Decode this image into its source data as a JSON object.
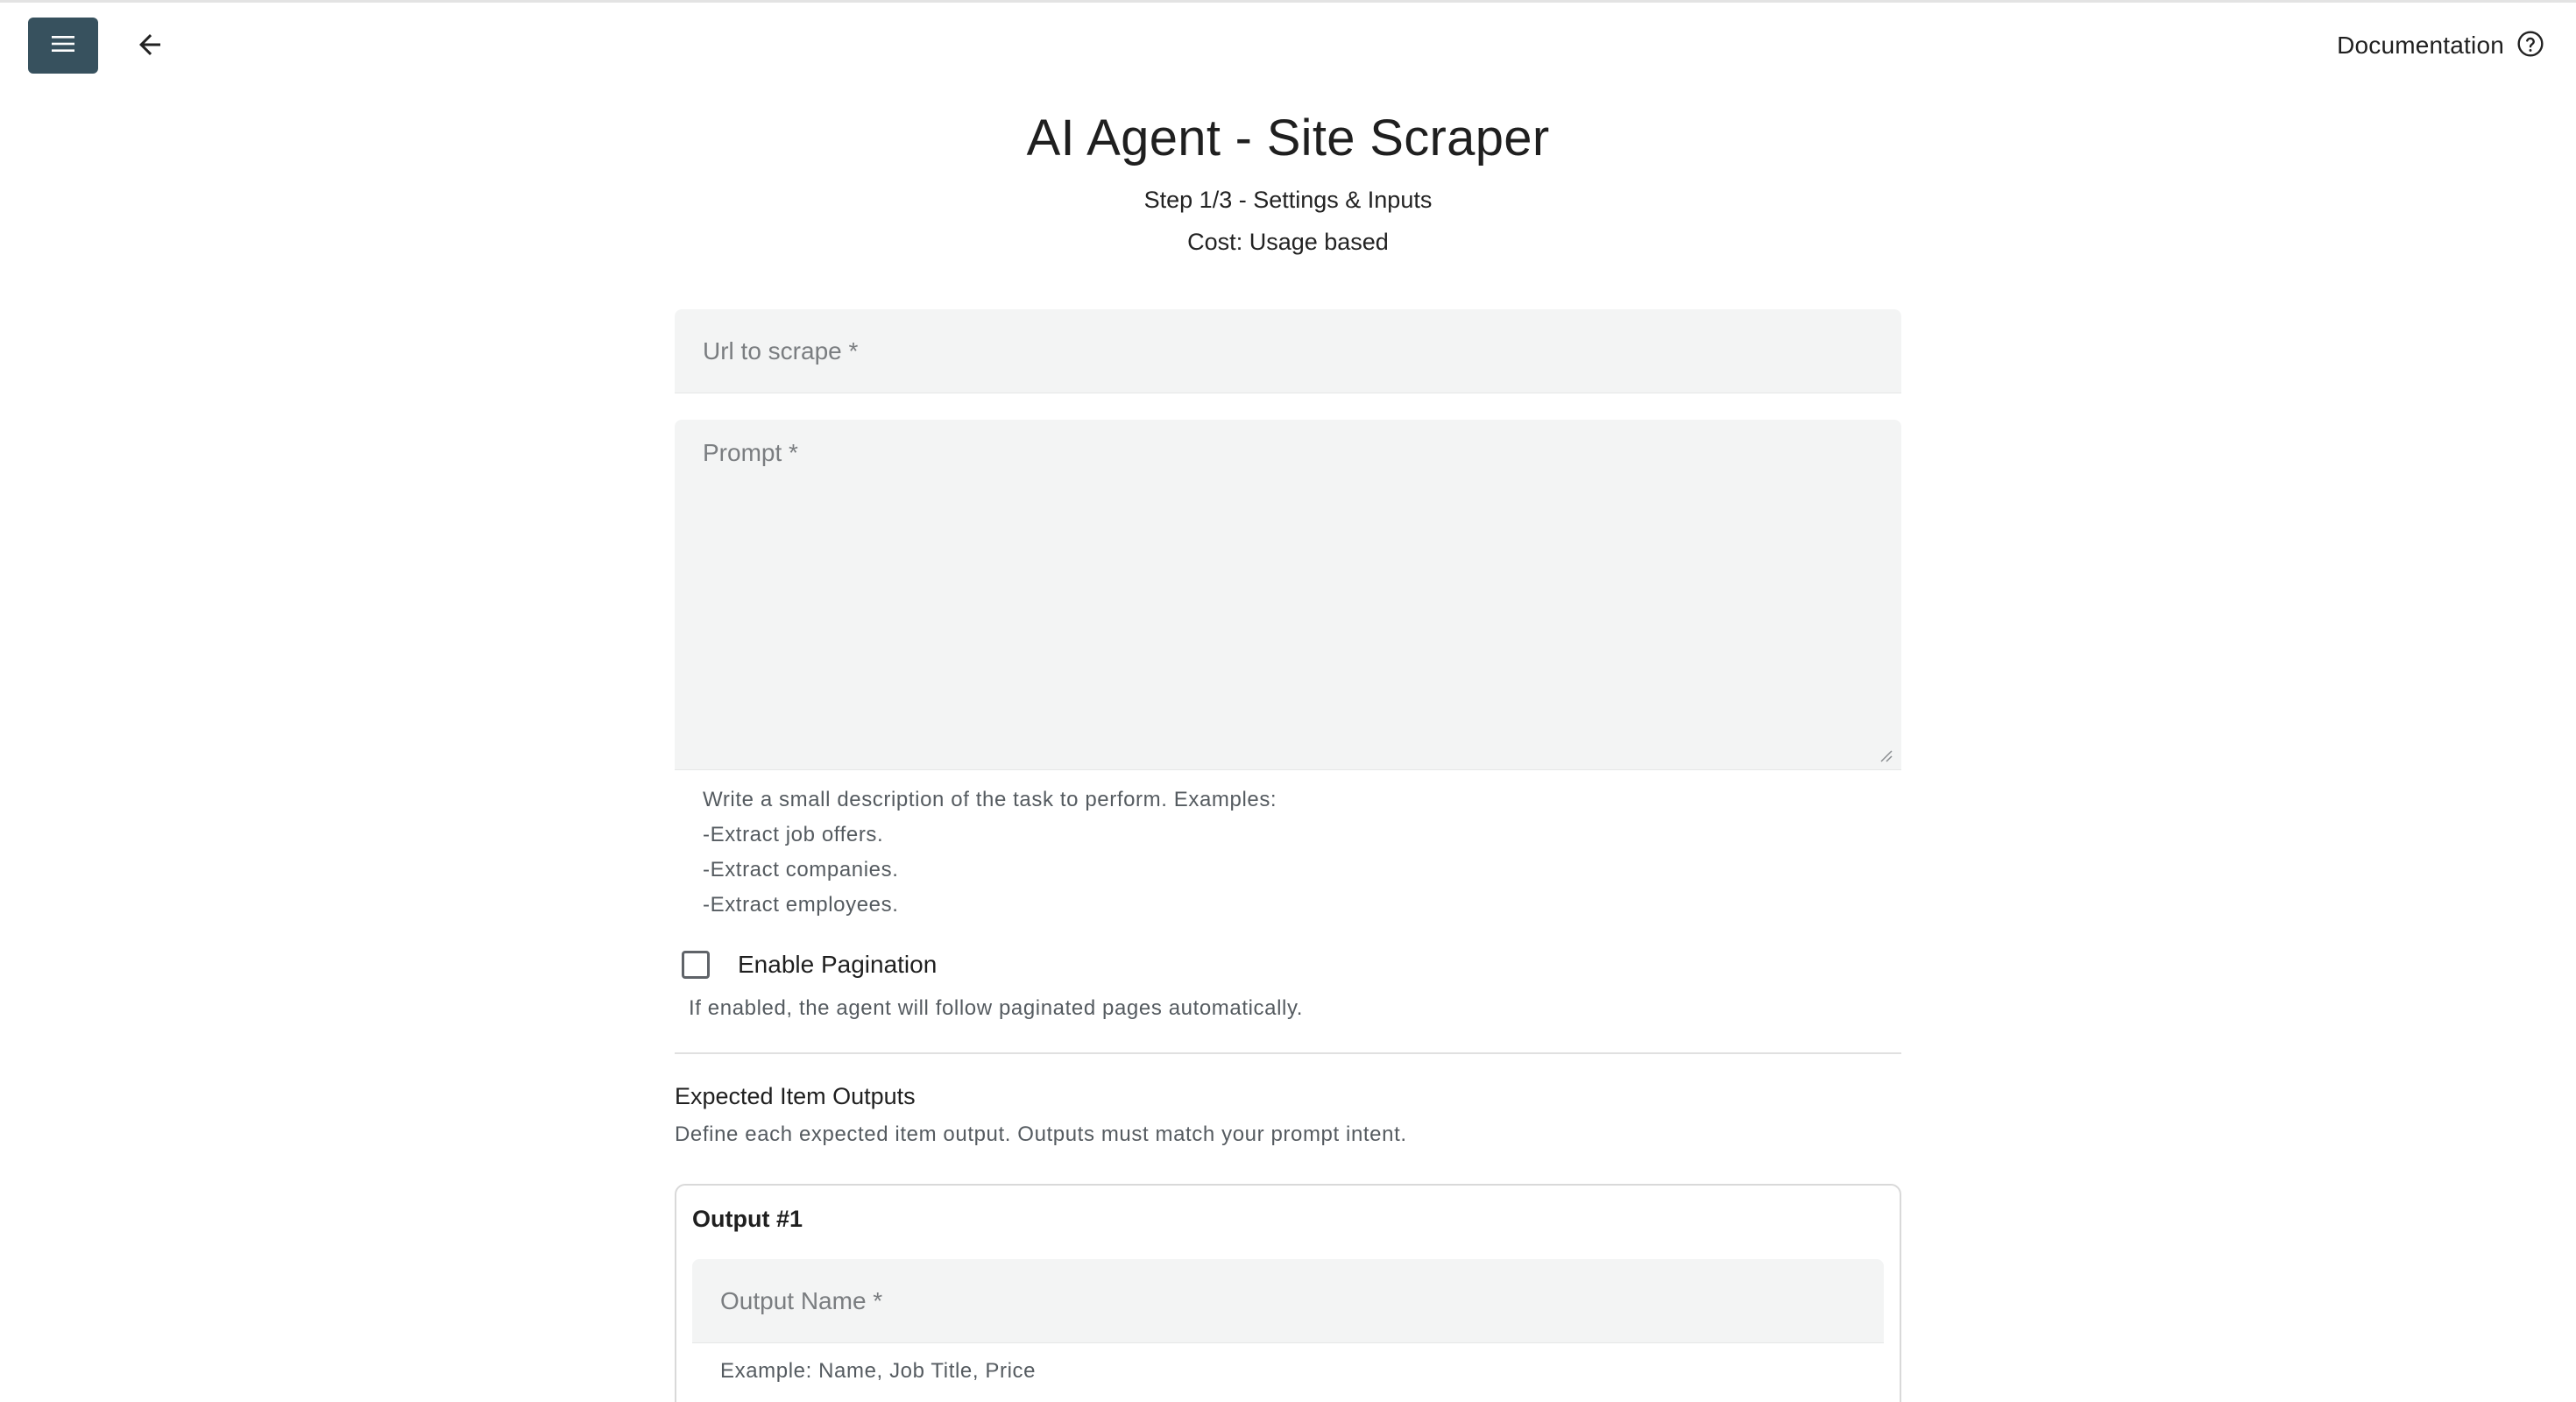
{
  "header": {
    "documentation_label": "Documentation"
  },
  "page": {
    "title": "AI Agent - Site Scraper",
    "step": "Step 1/3 - Settings & Inputs",
    "cost": "Cost: Usage based"
  },
  "form": {
    "url_label": "Url to scrape *",
    "prompt_label": "Prompt *",
    "prompt_helper": [
      "Write a small description of the task to perform. Examples:",
      "-Extract job offers.",
      "-Extract companies.",
      "-Extract employees."
    ],
    "pagination_label": "Enable Pagination",
    "pagination_checked": false,
    "pagination_hint": "If enabled, the agent will follow paginated pages automatically."
  },
  "outputs": {
    "section_title": "Expected Item Outputs",
    "section_desc": "Define each expected item output. Outputs must match your prompt intent.",
    "items": [
      {
        "title": "Output #1",
        "name_label": "Output Name *",
        "name_helper": "Example: Name, Job Title, Price"
      }
    ]
  },
  "icons": {
    "menu": "menu-icon",
    "back": "arrow-left-icon",
    "help": "help-circle-icon"
  },
  "colors": {
    "menu_button_bg": "#37515e",
    "field_bg": "#f3f4f4"
  }
}
